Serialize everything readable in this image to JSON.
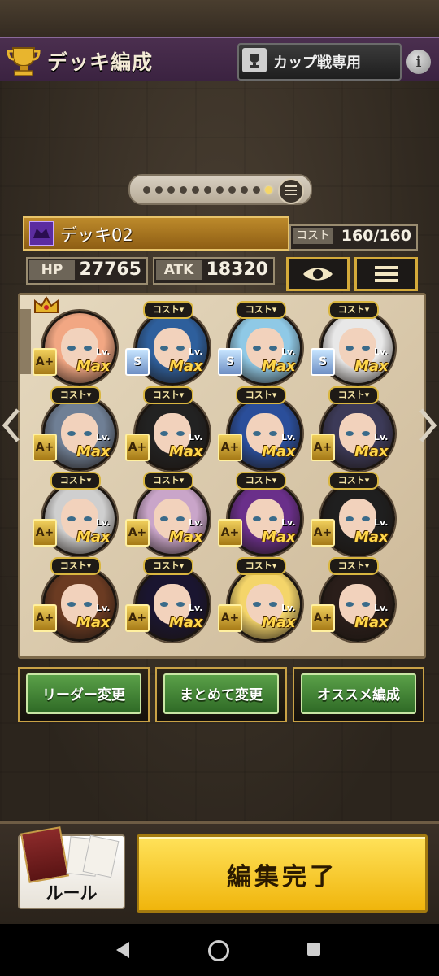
{
  "header": {
    "title": "デッキ編成",
    "cup_label": "カップ戦専用",
    "info_symbol": "i"
  },
  "pager": {
    "total_pages": 11,
    "active_index": 10
  },
  "deck": {
    "name": "デッキ02",
    "cost_label": "コスト",
    "cost_value": "160/160",
    "hp_label": "HP",
    "hp_value": "27765",
    "atk_label": "ATK",
    "atk_value": "18320"
  },
  "slots": [
    {
      "rank": "A+",
      "lv": "Lv.",
      "max": "Max",
      "cost": "",
      "hair": "#f2a783",
      "leader": true
    },
    {
      "rank": "S",
      "lv": "Lv.",
      "max": "Max",
      "cost": "コスト▾",
      "hair": "#2e5f9c"
    },
    {
      "rank": "S",
      "lv": "Lv.",
      "max": "Max",
      "cost": "コスト▾",
      "hair": "#8fc9e6"
    },
    {
      "rank": "S",
      "lv": "Lv.",
      "max": "Max",
      "cost": "コスト▾",
      "hair": "#e8e8e8"
    },
    {
      "rank": "A+",
      "lv": "Lv.",
      "max": "Max",
      "cost": "コスト▾",
      "hair": "#6f7f95"
    },
    {
      "rank": "A+",
      "lv": "Lv.",
      "max": "Max",
      "cost": "コスト▾",
      "hair": "#222222"
    },
    {
      "rank": "A+",
      "lv": "Lv.",
      "max": "Max",
      "cost": "コスト▾",
      "hair": "#2a4e9a"
    },
    {
      "rank": "A+",
      "lv": "Lv.",
      "max": "Max",
      "cost": "コスト▾",
      "hair": "#3c3a58"
    },
    {
      "rank": "A+",
      "lv": "Lv.",
      "max": "Max",
      "cost": "コスト▾",
      "hair": "#cfcfcf"
    },
    {
      "rank": "A+",
      "lv": "Lv.",
      "max": "Max",
      "cost": "コスト▾",
      "hair": "#c9a5c9"
    },
    {
      "rank": "A+",
      "lv": "Lv.",
      "max": "Max",
      "cost": "コスト▾",
      "hair": "#6a2f8a"
    },
    {
      "rank": "A+",
      "lv": "Lv.",
      "max": "Max",
      "cost": "コスト▾",
      "hair": "#1f1f1f"
    },
    {
      "rank": "A+",
      "lv": "Lv.",
      "max": "Max",
      "cost": "コスト▾",
      "hair": "#6b3b22"
    },
    {
      "rank": "A+",
      "lv": "Lv.",
      "max": "Max",
      "cost": "コスト▾",
      "hair": "#1a1530"
    },
    {
      "rank": "A+",
      "lv": "Lv.",
      "max": "Max",
      "cost": "コスト▾",
      "hair": "#f4d56a"
    },
    {
      "rank": "A+",
      "lv": "Lv.",
      "max": "Max",
      "cost": "コスト▾",
      "hair": "#2a1e1a"
    }
  ],
  "actions": {
    "leader_change": "リーダー変更",
    "bulk_change": "まとめて変更",
    "recommended": "オススメ編成"
  },
  "footer": {
    "rules": "ルール",
    "done": "編集完了"
  },
  "colors": {
    "header_purple": "#3a2240",
    "gold": "#d4aa3a",
    "green_button": "#3f8a34",
    "done_yellow": "#f8d22a"
  },
  "icons": [
    "trophy-icon",
    "cup-icon",
    "info-icon",
    "list-icon",
    "deck-icon",
    "eye-icon",
    "menu-icon",
    "crown-icon",
    "left-arrow-icon",
    "right-arrow-icon",
    "rulebook-icon",
    "nav-back-icon",
    "nav-home-icon",
    "nav-recent-icon"
  ]
}
